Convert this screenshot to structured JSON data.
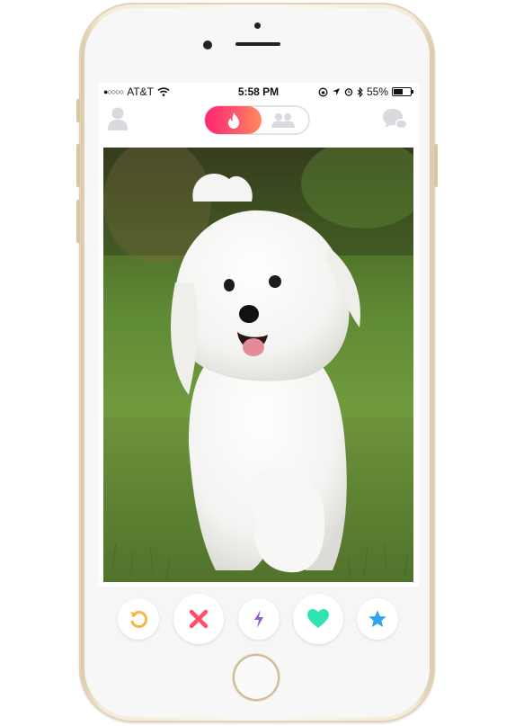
{
  "status_bar": {
    "signal": "●○○○○",
    "carrier": "AT&T",
    "time": "5:58 PM",
    "battery": "55%",
    "battery_level": 0.55
  },
  "nav": {
    "left_icon": "profile-icon",
    "toggle_active_icon": "flame-icon",
    "toggle_inactive_icon": "group-icon",
    "right_icon": "messages-icon"
  },
  "card": {
    "image": "photo of a white fluffy dog walking on grass"
  },
  "actions": [
    {
      "name": "rewind",
      "icon": "rewind-icon",
      "color": "#f5b748"
    },
    {
      "name": "nope",
      "icon": "close-icon",
      "color": "#fd5068"
    },
    {
      "name": "boost",
      "icon": "lightning-icon",
      "color": "#915dd1"
    },
    {
      "name": "like",
      "icon": "heart-icon",
      "color": "#2de4b2"
    },
    {
      "name": "super-like",
      "icon": "star-icon",
      "color": "#31a4f0"
    }
  ],
  "colors": {
    "brand_gradient_start": "#fd2672",
    "brand_gradient_end": "#ff8a5e",
    "inactive_icon": "#d9d9de"
  }
}
